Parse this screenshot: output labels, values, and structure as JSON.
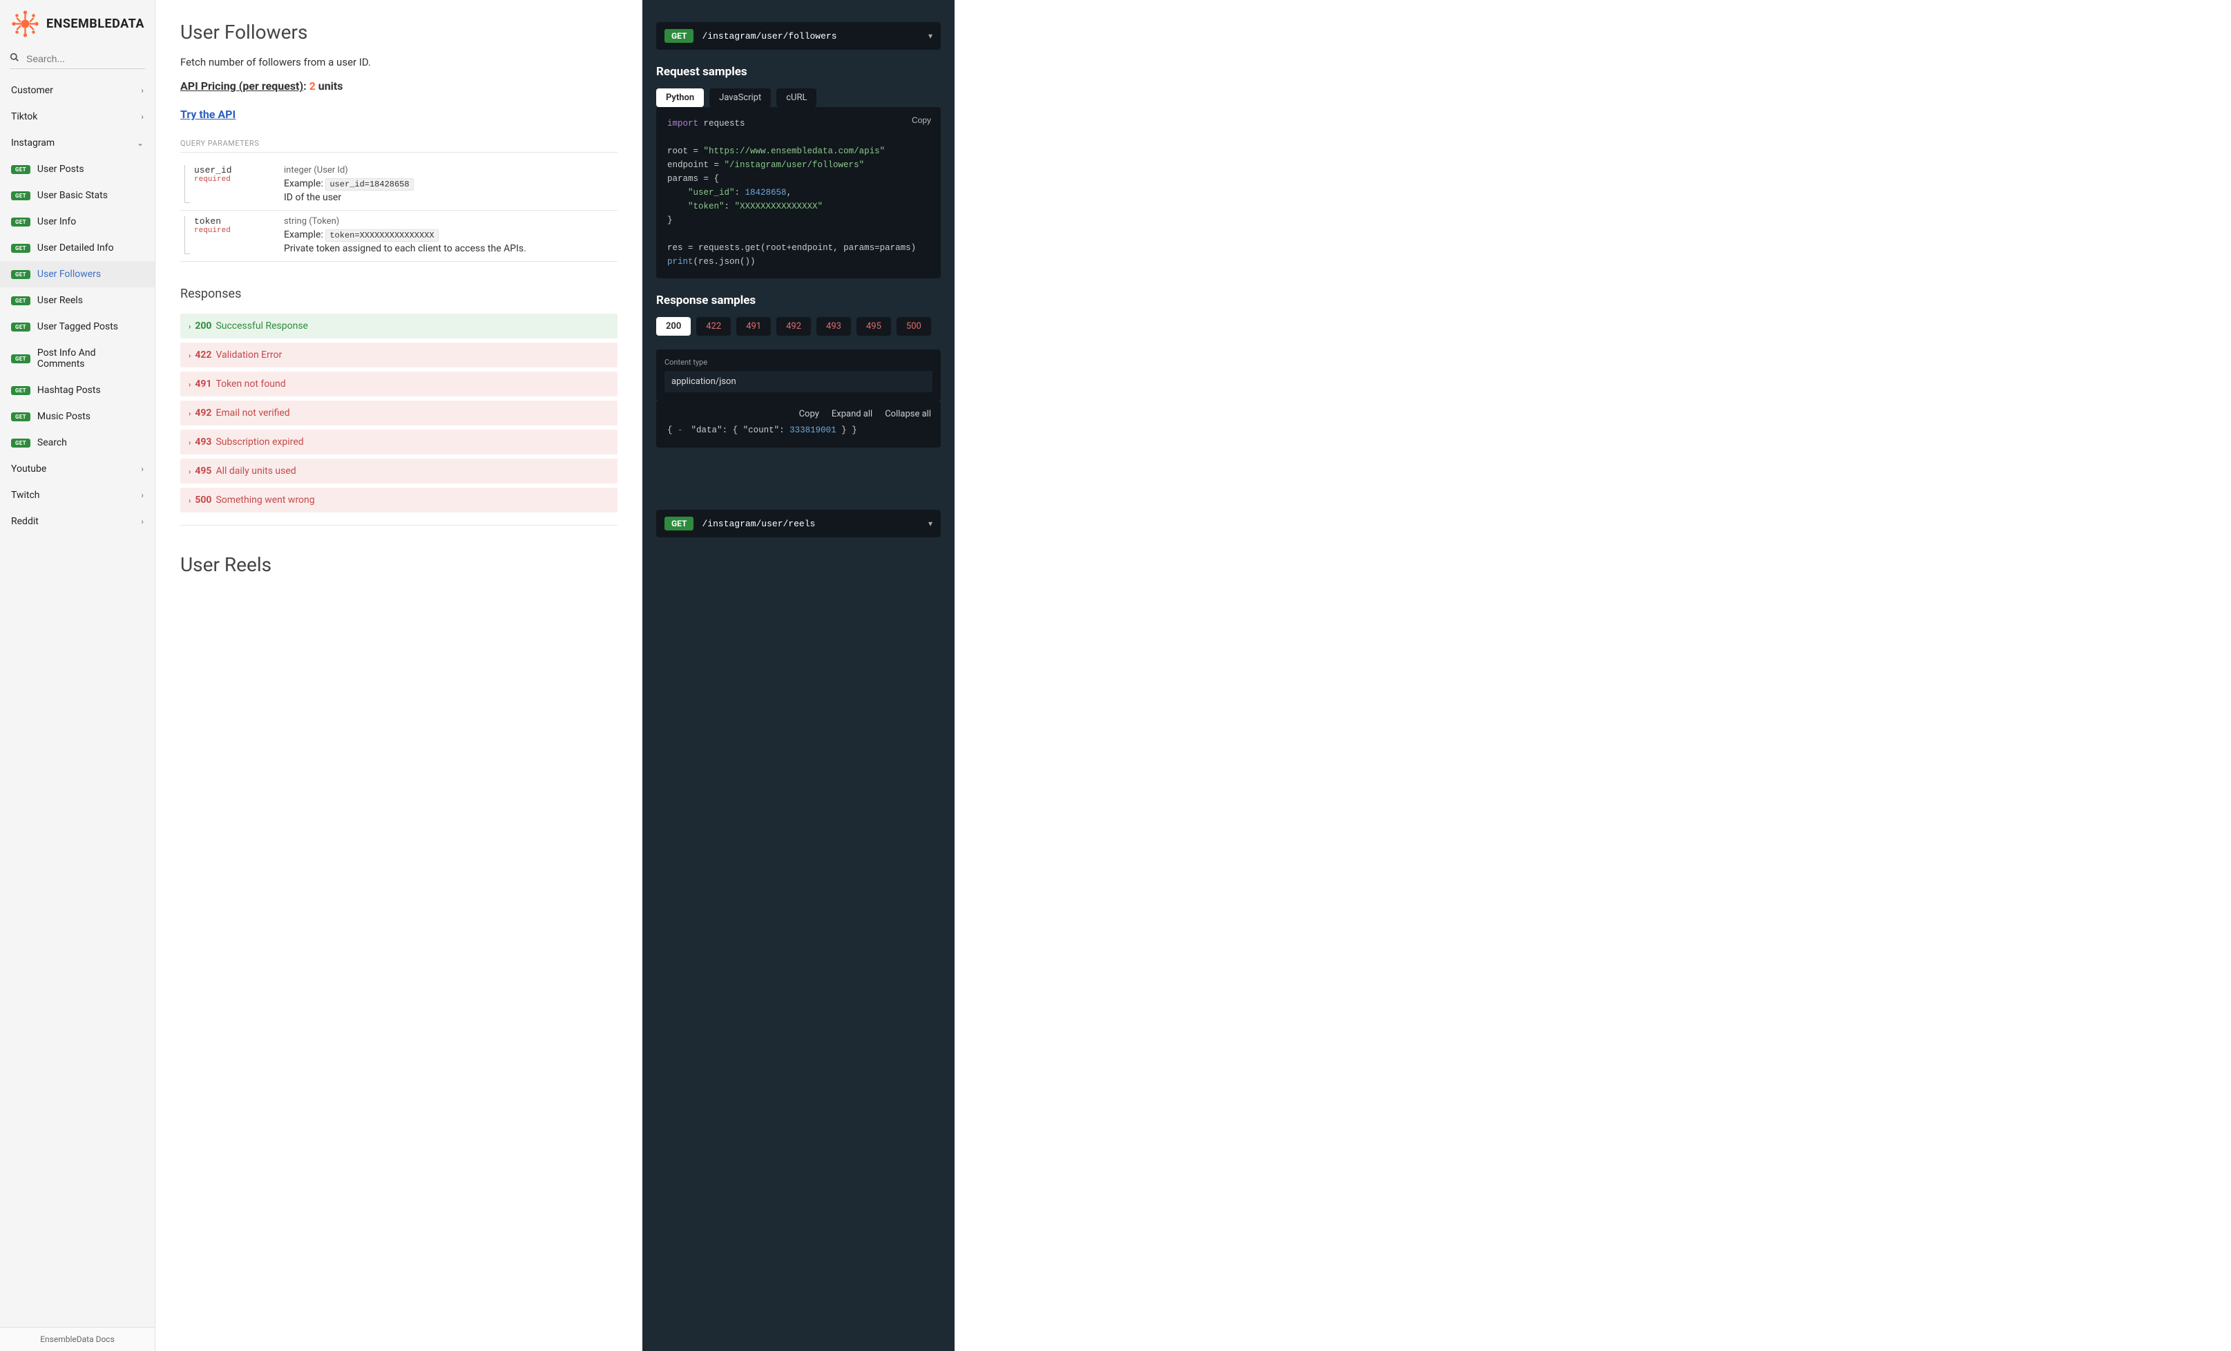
{
  "brand": "ENSEMBLEDATA",
  "search_placeholder": "Search...",
  "sidebar": {
    "groups": [
      {
        "label": "Customer",
        "expanded": false
      },
      {
        "label": "Tiktok",
        "expanded": false
      },
      {
        "label": "Instagram",
        "expanded": true,
        "items": [
          {
            "method": "GET",
            "label": "User Posts"
          },
          {
            "method": "GET",
            "label": "User Basic Stats"
          },
          {
            "method": "GET",
            "label": "User Info"
          },
          {
            "method": "GET",
            "label": "User Detailed Info"
          },
          {
            "method": "GET",
            "label": "User Followers",
            "active": true
          },
          {
            "method": "GET",
            "label": "User Reels"
          },
          {
            "method": "GET",
            "label": "User Tagged Posts"
          },
          {
            "method": "GET",
            "label": "Post Info And Comments"
          },
          {
            "method": "GET",
            "label": "Hashtag Posts"
          },
          {
            "method": "GET",
            "label": "Music Posts"
          },
          {
            "method": "GET",
            "label": "Search"
          }
        ]
      },
      {
        "label": "Youtube",
        "expanded": false
      },
      {
        "label": "Twitch",
        "expanded": false
      },
      {
        "label": "Reddit",
        "expanded": false
      }
    ],
    "footer": "EnsembleData Docs"
  },
  "endpoint": {
    "title": "User Followers",
    "description": "Fetch number of followers from a user ID.",
    "pricing_label": "API Pricing (per request)",
    "pricing_colon": ": ",
    "pricing_value": "2",
    "pricing_unit": " units",
    "try_label": "Try the API",
    "query_params_header": "QUERY PARAMETERS",
    "params": [
      {
        "name": "user_id",
        "required": "required",
        "type": "integer (User Id)",
        "example_prefix": "Example: ",
        "example": "user_id=18428658",
        "desc": "ID of the user"
      },
      {
        "name": "token",
        "required": "required",
        "type": "string (Token)",
        "example_prefix": "Example: ",
        "example": "token=XXXXXXXXXXXXXXX",
        "desc": "Private token assigned to each client to access the APIs."
      }
    ],
    "responses_header": "Responses",
    "responses": [
      {
        "code": "200",
        "msg": "Successful Response",
        "kind": "success"
      },
      {
        "code": "422",
        "msg": "Validation Error",
        "kind": "error"
      },
      {
        "code": "491",
        "msg": "Token not found",
        "kind": "error"
      },
      {
        "code": "492",
        "msg": "Email not verified",
        "kind": "error"
      },
      {
        "code": "493",
        "msg": "Subscription expired",
        "kind": "error"
      },
      {
        "code": "495",
        "msg": "All daily units used",
        "kind": "error"
      },
      {
        "code": "500",
        "msg": "Something went wrong",
        "kind": "error"
      }
    ]
  },
  "right": {
    "method": "GET",
    "path": "/instagram/user/followers",
    "request_samples_header": "Request samples",
    "req_tabs": [
      "Python",
      "JavaScript",
      "cURL"
    ],
    "copy_label": "Copy",
    "code": {
      "l1a": "import",
      "l1b": " requests",
      "l3a": "root ",
      "l3b": "=",
      "l3c": " \"https://www.ensembledata.com/apis\"",
      "l4a": "endpoint ",
      "l4b": "=",
      "l4c": " \"/instagram/user/followers\"",
      "l5a": "params ",
      "l5b": "=",
      "l5c": " {",
      "l6a": "    \"user_id\"",
      "l6b": ": ",
      "l6c": "18428658",
      "l6d": ",",
      "l7a": "    \"token\"",
      "l7b": ": ",
      "l7c": "\"XXXXXXXXXXXXXXX\"",
      "l8": "}",
      "l10a": "res ",
      "l10b": "=",
      "l10c": " requests.get(root",
      "l10d": "+",
      "l10e": "endpoint, params",
      "l10f": "=",
      "l10g": "params)",
      "l11a": "print",
      "l11b": "(res.json())"
    },
    "response_samples_header": "Response samples",
    "resp_tabs": [
      "200",
      "422",
      "491",
      "492",
      "493",
      "495",
      "500"
    ],
    "content_type_label": "Content type",
    "content_type_value": "application/json",
    "json_actions": {
      "copy": "Copy",
      "expand": "Expand all",
      "collapse": "Collapse all"
    },
    "json": {
      "open": "{",
      "close": "}",
      "data_key": "\"data\"",
      "data_open": ": {",
      "count_key": "\"count\"",
      "count_sep": ": ",
      "count_val": "333819001",
      "inner_close": "}"
    }
  },
  "next": {
    "title": "User Reels",
    "method": "GET",
    "path": "/instagram/user/reels"
  }
}
